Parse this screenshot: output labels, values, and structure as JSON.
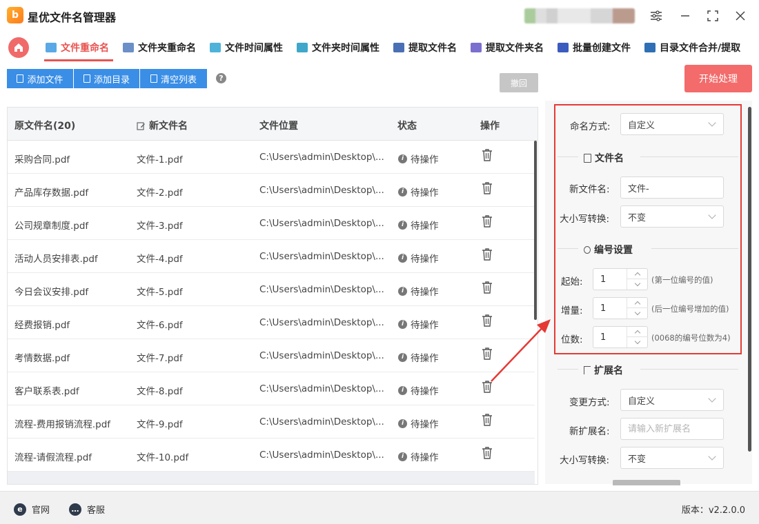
{
  "app": {
    "title": "星优文件名管理器",
    "logo_text": "b"
  },
  "tabs": [
    {
      "label": "文件重命名",
      "active": true
    },
    {
      "label": "文件夹重命名"
    },
    {
      "label": "文件时间属性"
    },
    {
      "label": "文件夹时间属性"
    },
    {
      "label": "提取文件名"
    },
    {
      "label": "提取文件夹名"
    },
    {
      "label": "批量创建文件"
    },
    {
      "label": "目录文件合并/提取"
    }
  ],
  "toolbar": {
    "add_file": "添加文件",
    "add_dir": "添加目录",
    "clear_list": "清空列表",
    "help": "?",
    "undo": "撤回",
    "start": "开始处理"
  },
  "table": {
    "headers": {
      "original": "原文件名(20)",
      "new": "新文件名",
      "location": "文件位置",
      "status": "状态",
      "action": "操作"
    },
    "rows": [
      {
        "original": "采购合同.pdf",
        "new": "文件-1.pdf",
        "location": "C:\\Users\\admin\\Desktop\\...",
        "status": "待操作"
      },
      {
        "original": "产品库存数据.pdf",
        "new": "文件-2.pdf",
        "location": "C:\\Users\\admin\\Desktop\\...",
        "status": "待操作"
      },
      {
        "original": "公司规章制度.pdf",
        "new": "文件-3.pdf",
        "location": "C:\\Users\\admin\\Desktop\\...",
        "status": "待操作"
      },
      {
        "original": "活动人员安排表.pdf",
        "new": "文件-4.pdf",
        "location": "C:\\Users\\admin\\Desktop\\...",
        "status": "待操作"
      },
      {
        "original": "今日会议安排.pdf",
        "new": "文件-5.pdf",
        "location": "C:\\Users\\admin\\Desktop\\...",
        "status": "待操作"
      },
      {
        "original": "经费报销.pdf",
        "new": "文件-6.pdf",
        "location": "C:\\Users\\admin\\Desktop\\...",
        "status": "待操作"
      },
      {
        "original": "考情数据.pdf",
        "new": "文件-7.pdf",
        "location": "C:\\Users\\admin\\Desktop\\...",
        "status": "待操作"
      },
      {
        "original": "客户联系表.pdf",
        "new": "文件-8.pdf",
        "location": "C:\\Users\\admin\\Desktop\\...",
        "status": "待操作"
      },
      {
        "original": "流程-费用报销流程.pdf",
        "new": "文件-9.pdf",
        "location": "C:\\Users\\admin\\Desktop\\...",
        "status": "待操作"
      },
      {
        "original": "流程-请假流程.pdf",
        "new": "文件-10.pdf",
        "location": "C:\\Users\\admin\\Desktop\\...",
        "status": "待操作"
      }
    ]
  },
  "panel": {
    "naming_mode_label": "命名方式:",
    "naming_mode_value": "自定义",
    "filename_section": "文件名",
    "new_name_label": "新文件名:",
    "new_name_value": "文件-",
    "case_label": "大小写转换:",
    "case_value": "不变",
    "numbering_section": "编号设置",
    "start_label": "起始:",
    "start_value": "1",
    "start_hint": "(第一位编号的值)",
    "step_label": "增量:",
    "step_value": "1",
    "step_hint": "(后一位编号增加的值)",
    "digits_label": "位数:",
    "digits_value": "1",
    "digits_hint": "(0068的编号位数为4)",
    "ext_section": "扩展名",
    "ext_mode_label": "变更方式:",
    "ext_mode_value": "自定义",
    "new_ext_label": "新扩展名:",
    "new_ext_placeholder": "请输入新扩展名",
    "ext_case_label": "大小写转换:",
    "ext_case_value": "不变"
  },
  "footer": {
    "website": "官网",
    "support": "客服",
    "version": "版本：v2.2.0.0"
  },
  "colors": {
    "accent": "#e8534f",
    "primary": "#3a8ee6",
    "highlight": "#e53935"
  }
}
